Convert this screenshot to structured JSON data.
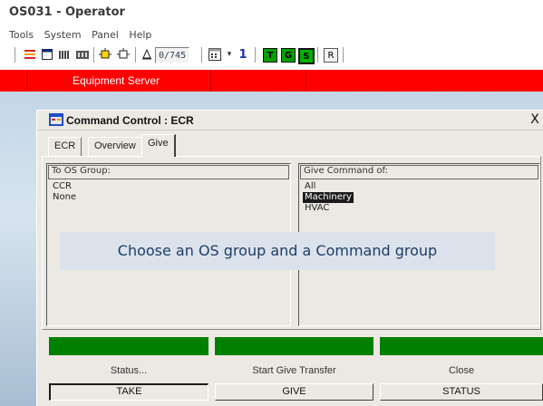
{
  "window": {
    "title": "OS031 - Operator"
  },
  "menu": [
    "Tools",
    "System",
    "Panel",
    "Help"
  ],
  "toolbar": {
    "counter": "0/745",
    "one_label": "1",
    "t_label": "T",
    "g_label": "G",
    "s_label": "S",
    "r_label": "R"
  },
  "server_bar": {
    "label": "Equipment Server"
  },
  "dialog": {
    "title": "Command Control : ECR",
    "close": "X",
    "tabs": [
      {
        "label": "ECR"
      },
      {
        "label": "Overview"
      },
      {
        "label": "Give"
      }
    ],
    "to_os_group": {
      "header": "To OS Group:",
      "items": [
        "CCR",
        "None"
      ]
    },
    "give_command": {
      "header": "Give Command of:",
      "items": [
        "All",
        "Machinery",
        "HVAC"
      ]
    }
  },
  "callout": "Choose an OS group and a Command group",
  "status": {
    "labels": [
      "Status...",
      "Start Give Transfer",
      "Close"
    ]
  },
  "buttons": {
    "take": "TAKE",
    "give": "GIVE",
    "status": "STATUS"
  },
  "colors": {
    "server_bar": "#ff0000",
    "status_indicator": "#008000"
  }
}
